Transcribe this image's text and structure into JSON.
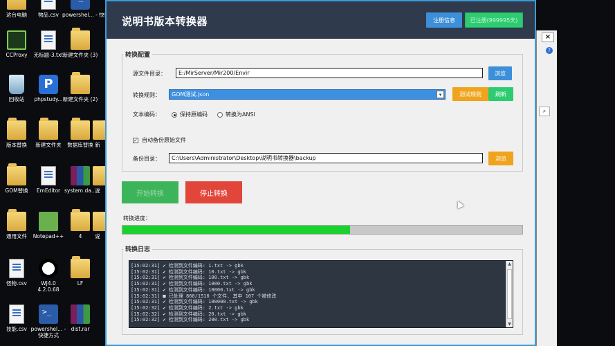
{
  "desktop": {
    "icons": [
      {
        "label": "这台电脑",
        "kind": "folder"
      },
      {
        "label": "物品.csv",
        "kind": "doc"
      },
      {
        "label": "powershel... - 快捷方式",
        "kind": "ps"
      },
      {
        "label": "CCProxy",
        "kind": "cc"
      },
      {
        "label": "无标题-3.txt",
        "kind": "doc"
      },
      {
        "label": "新建文件夹 (3)",
        "kind": "folder"
      },
      {
        "label": "回收站",
        "kind": "bin"
      },
      {
        "label": "phpstudy...",
        "kind": "php"
      },
      {
        "label": "新建文件夹 (2)",
        "kind": "folder"
      },
      {
        "label": "版本替换",
        "kind": "folder"
      },
      {
        "label": "新建文件夹",
        "kind": "folder"
      },
      {
        "label": "数据库替换",
        "kind": "folder"
      },
      {
        "label": "新",
        "kind": "folder"
      },
      {
        "label": "GOM替换",
        "kind": "folder"
      },
      {
        "label": "EmEditor",
        "kind": "doc"
      },
      {
        "label": "system.da...",
        "kind": "rar"
      },
      {
        "label": "说",
        "kind": "folder"
      },
      {
        "label": "通用文件",
        "kind": "folder"
      },
      {
        "label": "Notepad++",
        "kind": "np"
      },
      {
        "label": "4",
        "kind": "folder"
      },
      {
        "label": "说",
        "kind": "folder"
      },
      {
        "label": "怪物.csv",
        "kind": "doc"
      },
      {
        "label": "WJ4.0 4.2.0.68",
        "kind": "yy"
      },
      {
        "label": "LF",
        "kind": "folder"
      },
      {
        "label": "技能.csv",
        "kind": "doc"
      },
      {
        "label": "powershel... - 快捷方式",
        "kind": "ps"
      },
      {
        "label": "dist.rar",
        "kind": "rar"
      }
    ]
  },
  "app": {
    "title": "说明书版本转换器",
    "register_label": "注册信息",
    "registered_label": "已注册(999995天)"
  },
  "config": {
    "legend": "转换配置",
    "source_label": "源文件目录：",
    "source_value": "E:/MirServer/Mir200/Envir",
    "browse_label": "浏览",
    "rule_label": "转换规则：",
    "rule_value": "GOM测试.json",
    "test_rule_label": "测试规则",
    "refresh_label": "刷新",
    "encoding_label": "文本编码：",
    "encoding_options": [
      "保持原编码",
      "转换为ANSI"
    ],
    "encoding_selected": "保持原编码",
    "backup_check_label": "自动备份原始文件",
    "backup_checked": true,
    "backup_dir_label": "备份目录：",
    "backup_dir_value": "C:\\Users\\Administrator\\Desktop\\说明书转换器\\backup",
    "backup_browse_label": "浏览"
  },
  "actions": {
    "start_label": "开始转换",
    "stop_label": "停止转换"
  },
  "progress": {
    "label": "转换进度：",
    "value": 0.57
  },
  "log": {
    "legend": "转换日志",
    "lines": [
      "[15:02:31] ✔ 检测到文件编码: 1.txt -> gbk",
      "[15:02:31] ✔ 检测到文件编码: 10.txt -> gbk",
      "[15:02:31] ✔ 检测到文件编码: 100.txt -> gbk",
      "[15:02:31] ✔ 检测到文件编码: 1000.txt -> gbk",
      "[15:02:31] ✔ 检测到文件编码: 10000.txt -> gbk",
      "[15:02:31] ■ 已处理 860/1510 个文件, 其中 107 个被修改",
      "[15:02:31] ✔ 检测到文件编码: 100000.txt -> gbk",
      "[15:02:32] ✔ 检测到文件编码: 2.txt -> gbk",
      "[15:02:32] ✔ 检测到文件编码: 20.txt -> gbk",
      "[15:02:32] ✔ 检测到文件编码: 200.txt -> gbk"
    ]
  },
  "background_window": {
    "close_label": "×",
    "help_label": "?",
    "search_label": "⌕"
  }
}
